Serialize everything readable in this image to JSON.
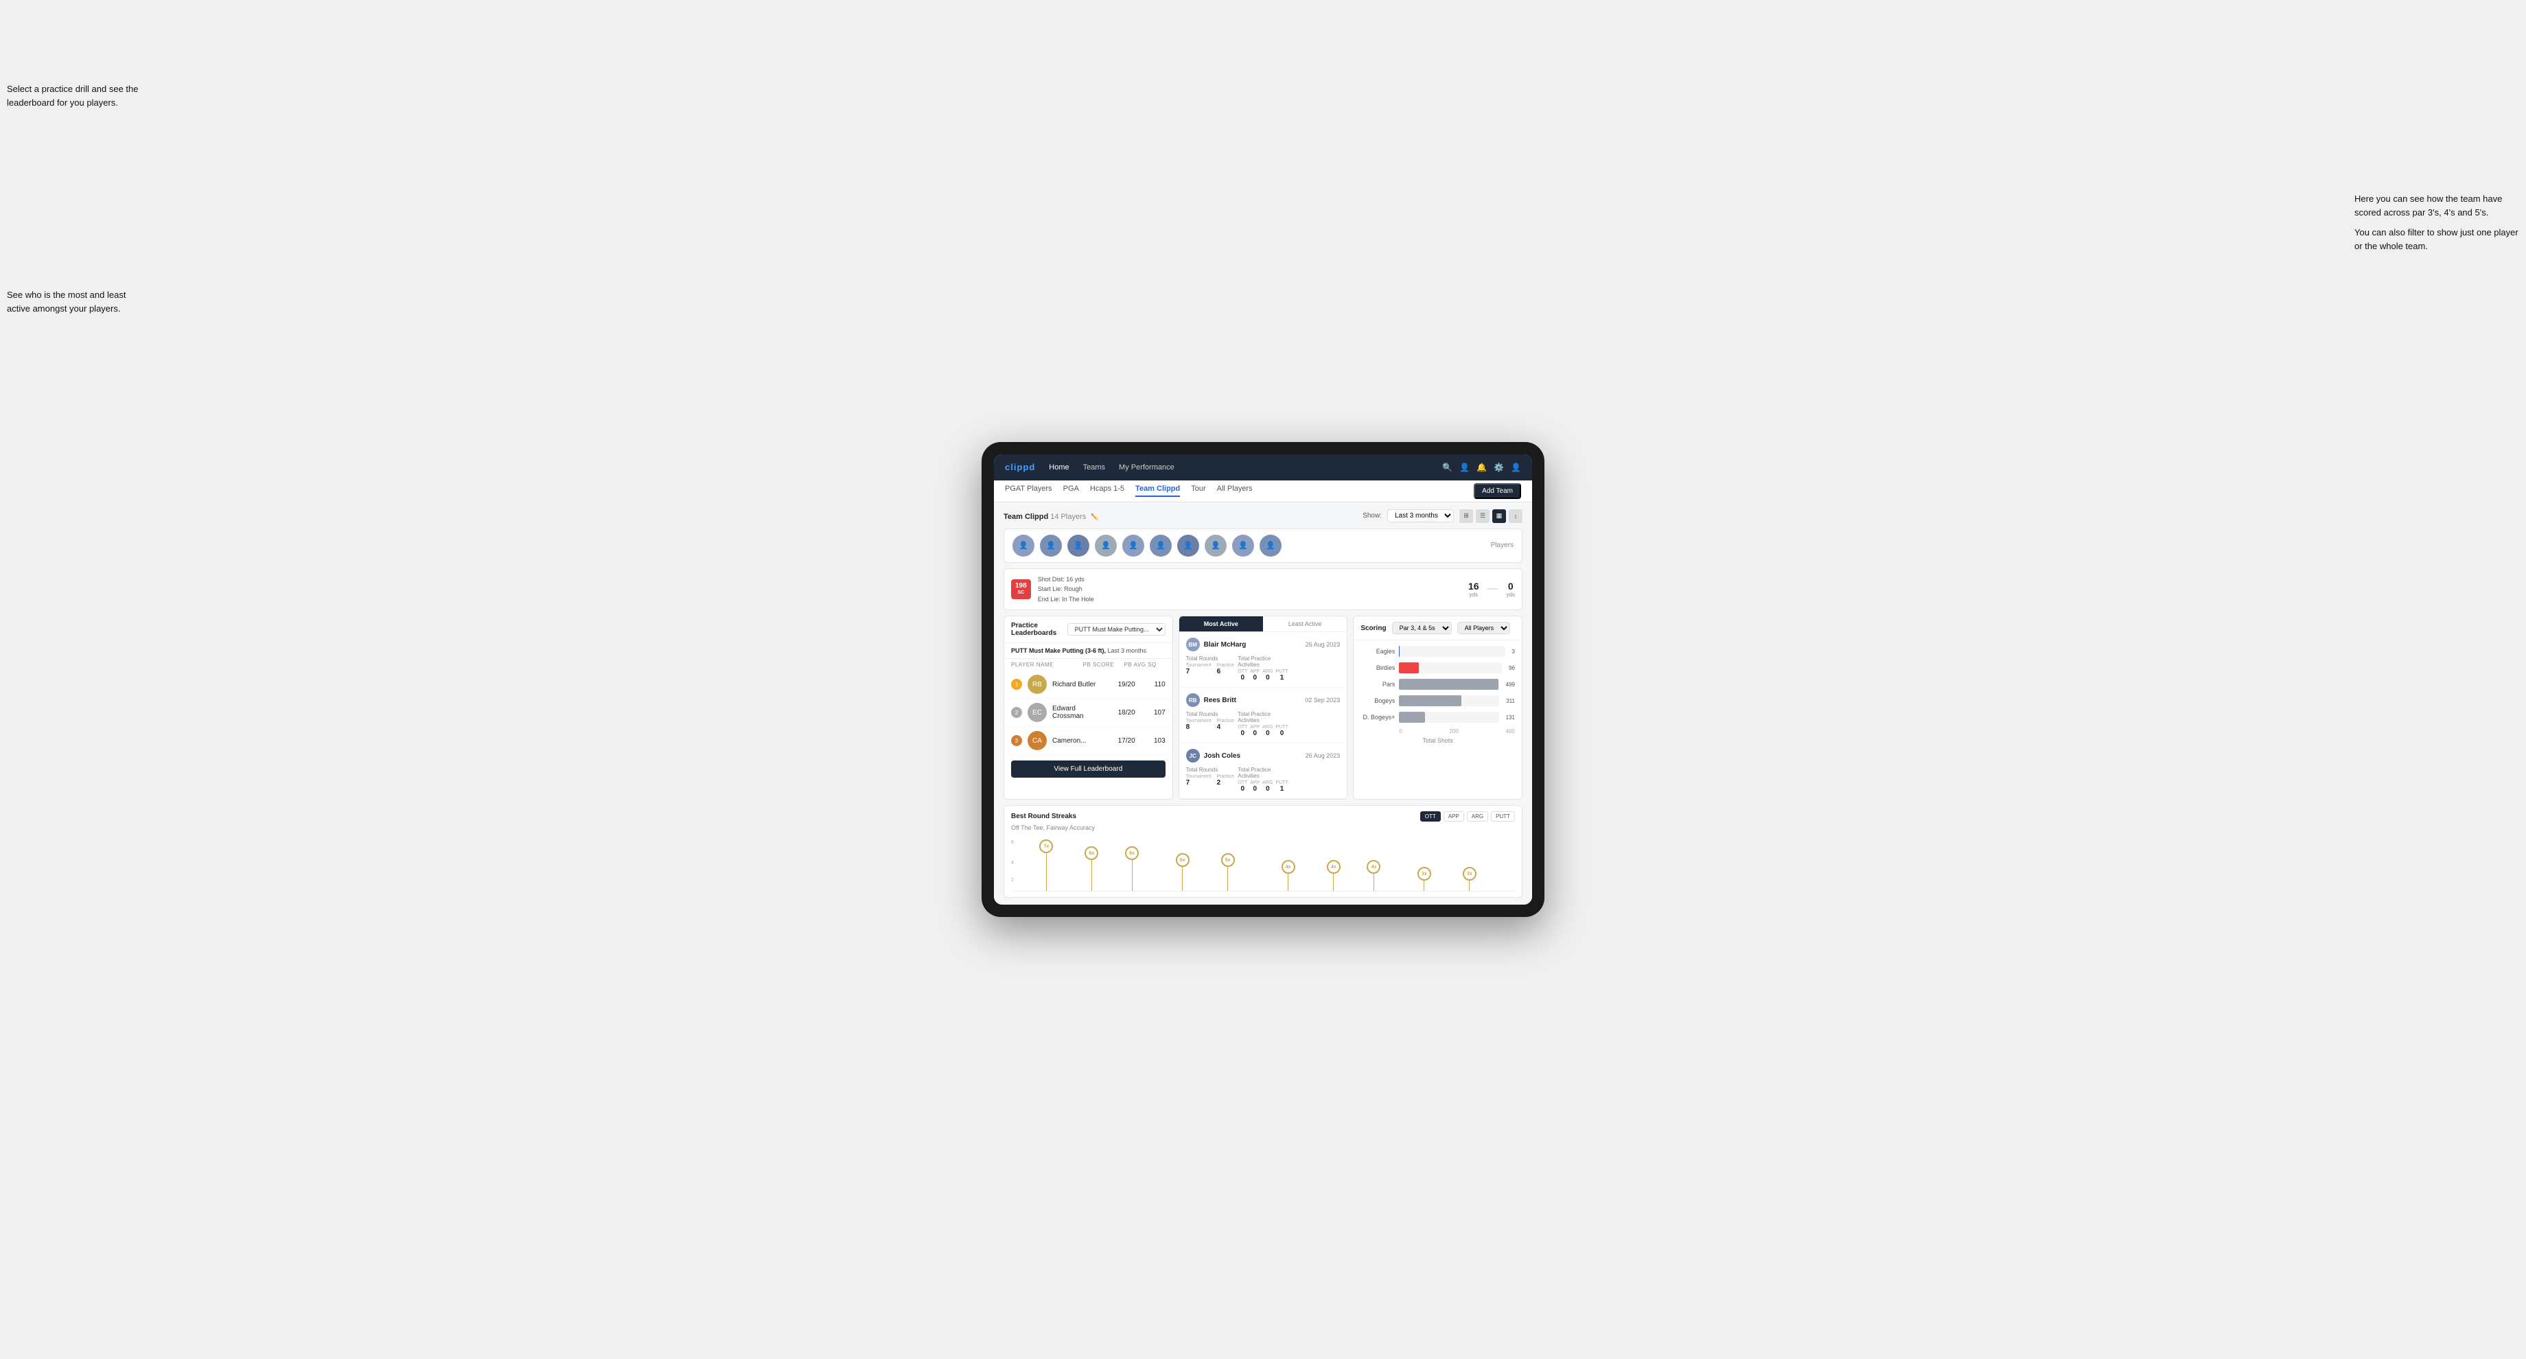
{
  "annotations": {
    "top_left": "Select a practice drill and see the leaderboard for you players.",
    "bottom_left": "See who is the most and least active amongst your players.",
    "top_right_line1": "Here you can see how the team have scored across par 3's, 4's and 5's.",
    "top_right_line2": "You can also filter to show just one player or the whole team."
  },
  "navbar": {
    "brand": "clippd",
    "links": [
      "Home",
      "Teams",
      "My Performance"
    ],
    "icons": [
      "search",
      "person",
      "bell",
      "settings",
      "user"
    ]
  },
  "tabs": {
    "items": [
      "PGAT Players",
      "PGA",
      "Hcaps 1-5",
      "Team Clippd",
      "Tour",
      "All Players"
    ],
    "active": "Team Clippd",
    "add_button": "Add Team"
  },
  "team": {
    "name": "Team Clippd",
    "player_count": "14 Players",
    "show_label": "Show:",
    "show_value": "Last 3 months"
  },
  "shot_card": {
    "badge_val": "198",
    "badge_unit": "SC",
    "info_line1": "Shot Dist: 16 yds",
    "info_line2": "Start Lie: Rough",
    "info_line3": "End Lie: In The Hole",
    "num1_val": "16",
    "num1_lbl": "yds",
    "num2_val": "0",
    "num2_lbl": "yds"
  },
  "practice_leaderboard": {
    "title": "Practice Leaderboards",
    "drill": "PUTT Must Make Putting...",
    "subtitle": "PUTT Must Make Putting (3-6 ft),",
    "period": "Last 3 months",
    "col1": "PLAYER NAME",
    "col2": "PB SCORE",
    "col3": "PB AVG SQ",
    "players": [
      {
        "name": "Richard Butler",
        "score": "19/20",
        "avg": "110",
        "rank": 1,
        "initials": "RB"
      },
      {
        "name": "Edward Crossman",
        "score": "18/20",
        "avg": "107",
        "rank": 2,
        "initials": "EC"
      },
      {
        "name": "Cameron...",
        "score": "17/20",
        "avg": "103",
        "rank": 3,
        "initials": "CA"
      }
    ],
    "view_full_btn": "View Full Leaderboard"
  },
  "activity": {
    "tab_most": "Most Active",
    "tab_least": "Least Active",
    "players": [
      {
        "name": "Blair McHarg",
        "date": "26 Aug 2023",
        "total_rounds_label": "Total Rounds",
        "tournament_label": "Tournament",
        "tournament_val": "7",
        "practice_label": "Practice",
        "practice_val": "6",
        "tpa_label": "Total Practice Activities",
        "ott": "0",
        "app": "0",
        "arg": "0",
        "putt": "1"
      },
      {
        "name": "Rees Britt",
        "date": "02 Sep 2023",
        "total_rounds_label": "Total Rounds",
        "tournament_label": "Tournament",
        "tournament_val": "8",
        "practice_label": "Practice",
        "practice_val": "4",
        "tpa_label": "Total Practice Activities",
        "ott": "0",
        "app": "0",
        "arg": "0",
        "putt": "0"
      },
      {
        "name": "Josh Coles",
        "date": "26 Aug 2023",
        "total_rounds_label": "Total Rounds",
        "tournament_label": "Tournament",
        "tournament_val": "7",
        "practice_label": "Practice",
        "practice_val": "2",
        "tpa_label": "Total Practice Activities",
        "ott": "0",
        "app": "0",
        "arg": "0",
        "putt": "1"
      }
    ]
  },
  "scoring": {
    "title": "Scoring",
    "filter1": "Par 3, 4 & 5s",
    "filter2": "All Players",
    "bars": [
      {
        "label": "Eagles",
        "value": 3,
        "max": 500,
        "color": "#2563eb"
      },
      {
        "label": "Birdies",
        "value": 96,
        "max": 500,
        "color": "#ef4444"
      },
      {
        "label": "Pars",
        "value": 499,
        "max": 500,
        "color": "#9ca3af"
      },
      {
        "label": "Bogeys",
        "value": 311,
        "max": 500,
        "color": "#9ca3af"
      },
      {
        "label": "D. Bogeys+",
        "value": 131,
        "max": 500,
        "color": "#9ca3af"
      }
    ],
    "x_labels": [
      "0",
      "200",
      "400"
    ],
    "x_title": "Total Shots"
  },
  "streaks": {
    "title": "Best Round Streaks",
    "subtitle": "Off The Tee, Fairway Accuracy",
    "btns": [
      "OTT",
      "APP",
      "ARG",
      "PUTT"
    ],
    "active_btn": "OTT",
    "dots": [
      {
        "label": "7x",
        "left_pct": 7
      },
      {
        "label": "6x",
        "left_pct": 17
      },
      {
        "label": "6x",
        "left_pct": 24
      },
      {
        "label": "5x",
        "left_pct": 35
      },
      {
        "label": "5x",
        "left_pct": 43
      },
      {
        "label": "4x",
        "left_pct": 55
      },
      {
        "label": "4x",
        "left_pct": 63
      },
      {
        "label": "4x",
        "left_pct": 71
      },
      {
        "label": "3x",
        "left_pct": 82
      },
      {
        "label": "3x",
        "left_pct": 90
      }
    ]
  },
  "avatars": [
    "#8b9dc3",
    "#7a8fb5",
    "#6b80a8",
    "#9dabb9",
    "#8b9dc3",
    "#7a8fb5",
    "#6b80a8",
    "#9dabb9",
    "#8b9dc3",
    "#7a8fb5"
  ]
}
